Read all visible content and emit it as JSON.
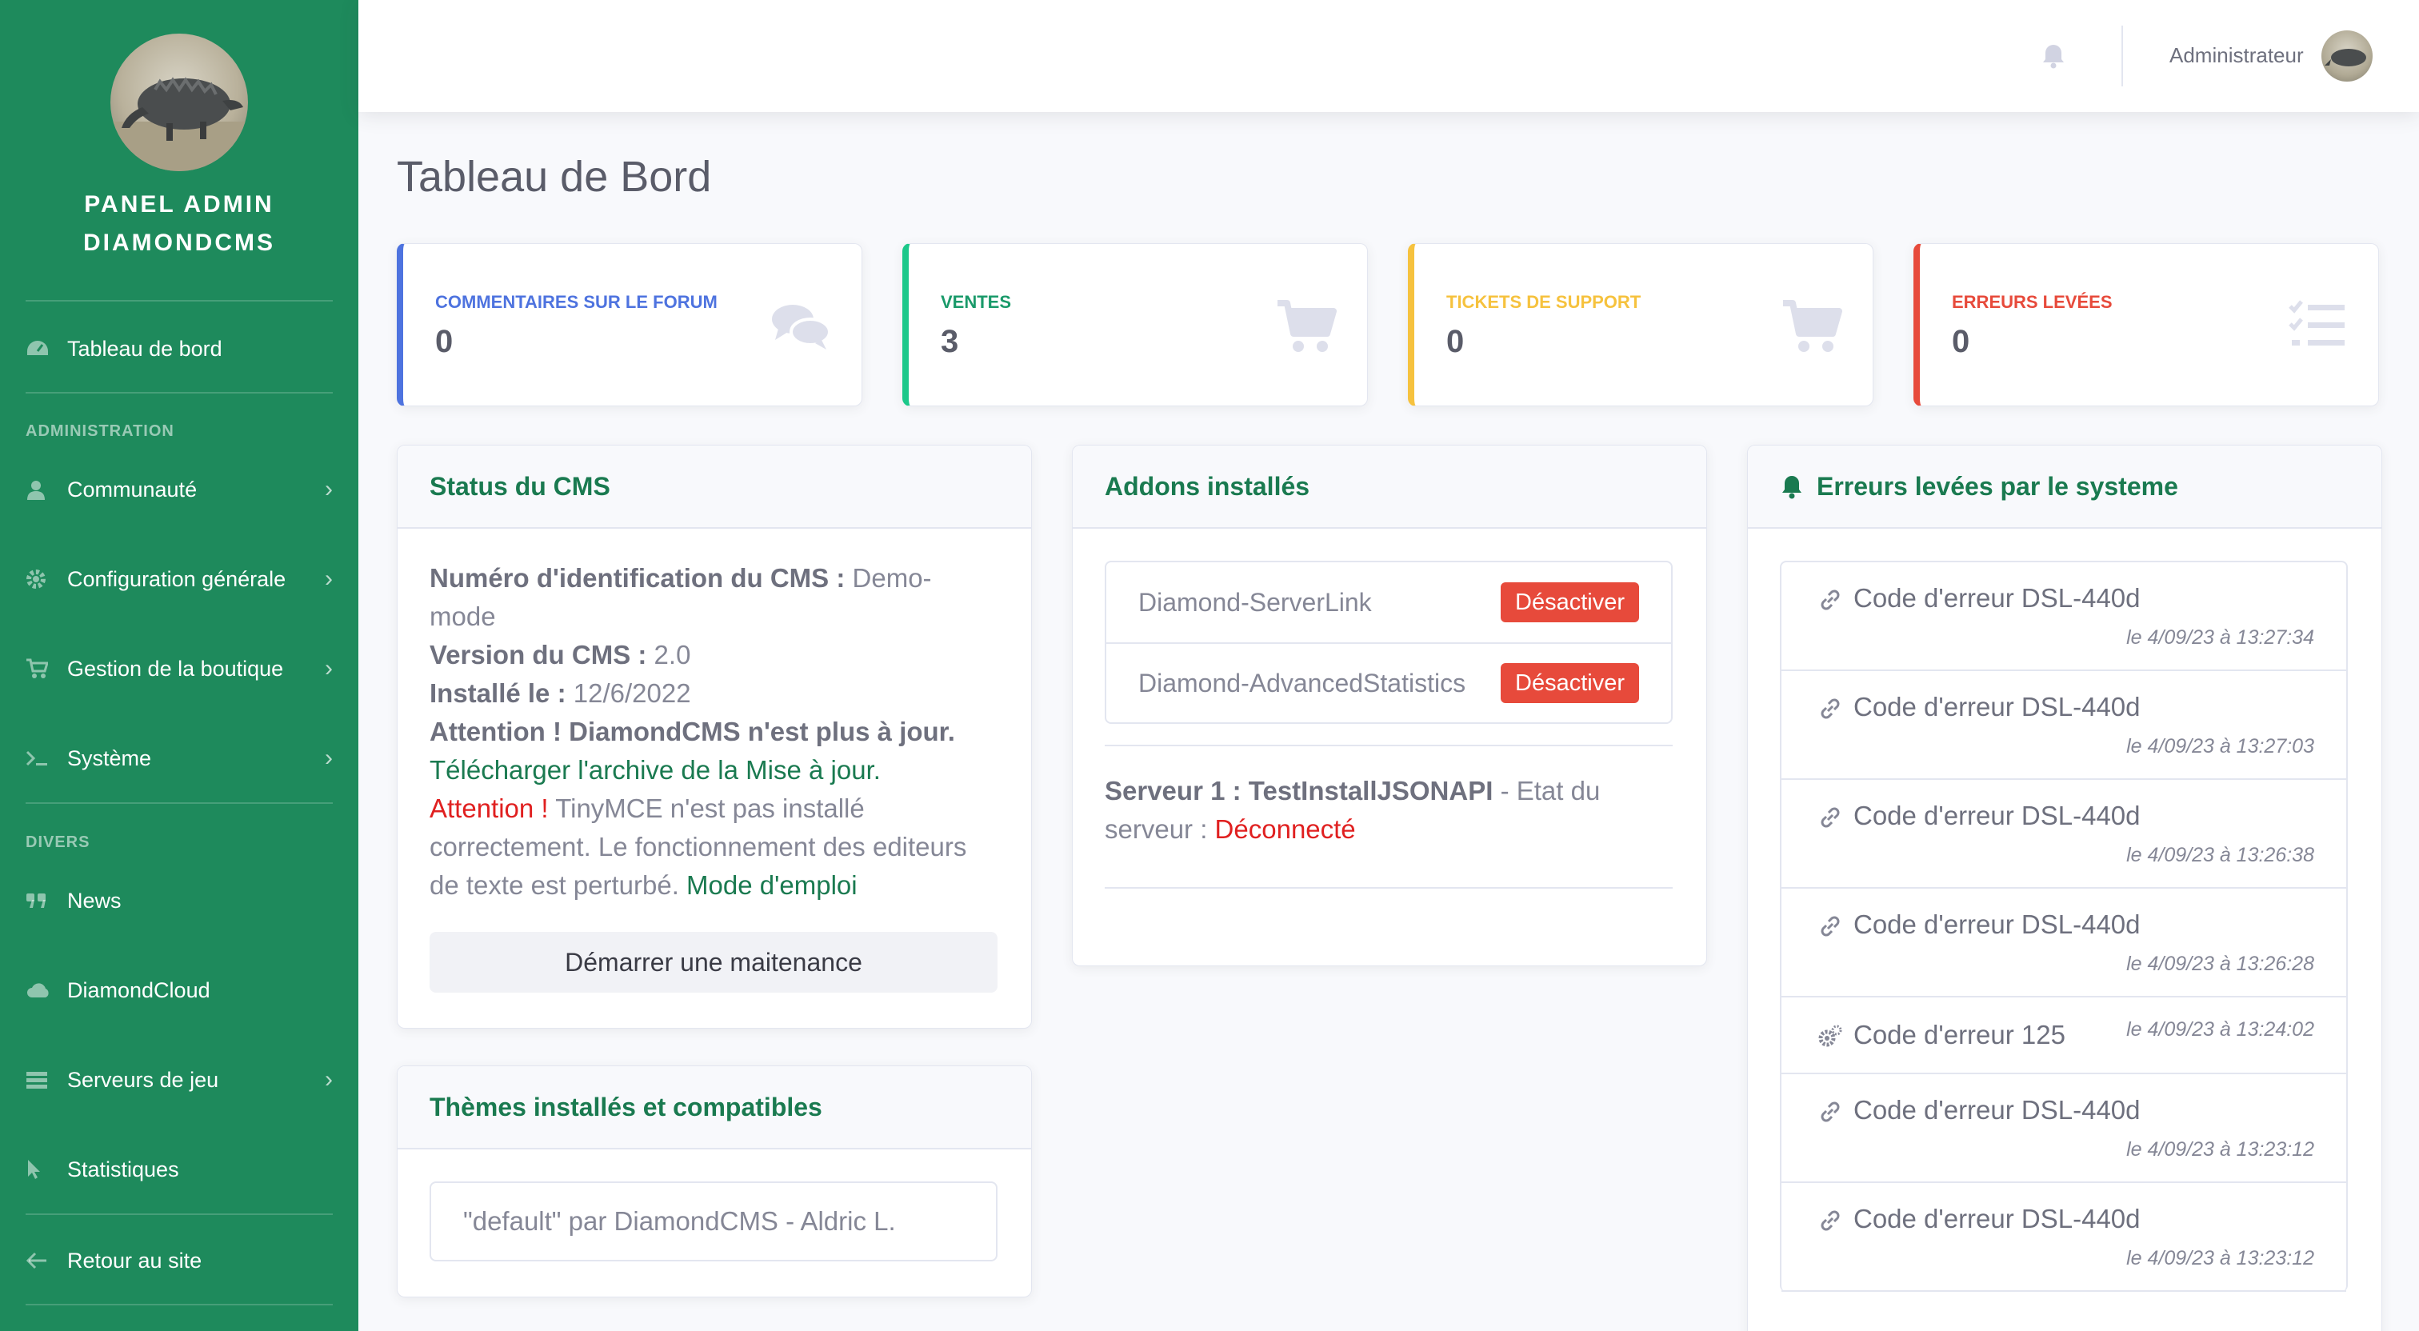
{
  "sidebar": {
    "brand_line1": "PANEL ADMIN",
    "brand_line2": "DIAMONDCMS",
    "dashboard": "Tableau de bord",
    "heading_admin": "ADMINISTRATION",
    "community": "Communauté",
    "config": "Configuration générale",
    "shop": "Gestion de la boutique",
    "system": "Système",
    "heading_misc": "DIVERS",
    "news": "News",
    "cloud": "DiamondCloud",
    "servers": "Serveurs de jeu",
    "stats": "Statistiques",
    "back": "Retour au site"
  },
  "topbar": {
    "user_name": "Administrateur"
  },
  "page": {
    "title": "Tableau de Bord"
  },
  "stats": [
    {
      "label": "COMMENTAIRES SUR LE FORUM",
      "value": "0",
      "color": "#4e73df",
      "icon": "comments-icon"
    },
    {
      "label": "VENTES",
      "value": "3",
      "color": "#1cc88a",
      "icon": "cart-icon"
    },
    {
      "label": "TICKETS DE SUPPORT",
      "value": "0",
      "color": "#f6c23e",
      "icon": "cart-icon"
    },
    {
      "label": "ERREURS LEVÉES",
      "value": "0",
      "color": "#e74a3b",
      "icon": "tasks-icon"
    }
  ],
  "cms_status": {
    "title": "Status du CMS",
    "id_label": "Numéro d'identification du CMS :",
    "id_value": "Demo-mode",
    "version_label": "Version du CMS :",
    "version_value": "2.0",
    "installed_label": "Installé le :",
    "installed_value": "12/6/2022",
    "warn1_prefix": "Attention !",
    "warn1_text": "DiamondCMS n'est plus à jour.",
    "download_link": "Télécharger l'archive de la Mise à jour.",
    "warn2_prefix": "Attention !",
    "warn2_text": "TinyMCE n'est pas installé correctement. Le fonctionnement des editeurs de texte est perturbé.",
    "manual_link": "Mode d'emploi",
    "maintenance_button": "Démarrer une maitenance"
  },
  "themes": {
    "title": "Thèmes installés et compatibles",
    "item": "\"default\" par DiamondCMS - Aldric L."
  },
  "addons": {
    "title": "Addons installés",
    "items": [
      {
        "name": "Diamond-ServerLink",
        "button": "Désactiver"
      },
      {
        "name": "Diamond-AdvancedStatistics",
        "button": "Désactiver"
      }
    ],
    "server_label": "Serveur 1 : TestInstallJSONAPI",
    "server_state_text": "- Etat du serveur :",
    "server_state": "Déconnecté"
  },
  "errors": {
    "title": "Erreurs levées par le systeme",
    "items": [
      {
        "code": "Code d'erreur DSL-440d",
        "date": "le 4/09/23 à 13:27:34",
        "icon": "link-icon"
      },
      {
        "code": "Code d'erreur DSL-440d",
        "date": "le 4/09/23 à 13:27:03",
        "icon": "link-icon"
      },
      {
        "code": "Code d'erreur DSL-440d",
        "date": "le 4/09/23 à 13:26:38",
        "icon": "link-icon"
      },
      {
        "code": "Code d'erreur DSL-440d",
        "date": "le 4/09/23 à 13:26:28",
        "icon": "link-icon"
      },
      {
        "code": "Code d'erreur 125",
        "date": "le 4/09/23 à 13:24:02",
        "icon": "cogs-icon"
      },
      {
        "code": "Code d'erreur DSL-440d",
        "date": "le 4/09/23 à 13:23:12",
        "icon": "link-icon"
      },
      {
        "code": "Code d'erreur DSL-440d",
        "date": "le 4/09/23 à 13:23:12",
        "icon": "link-icon"
      }
    ]
  }
}
